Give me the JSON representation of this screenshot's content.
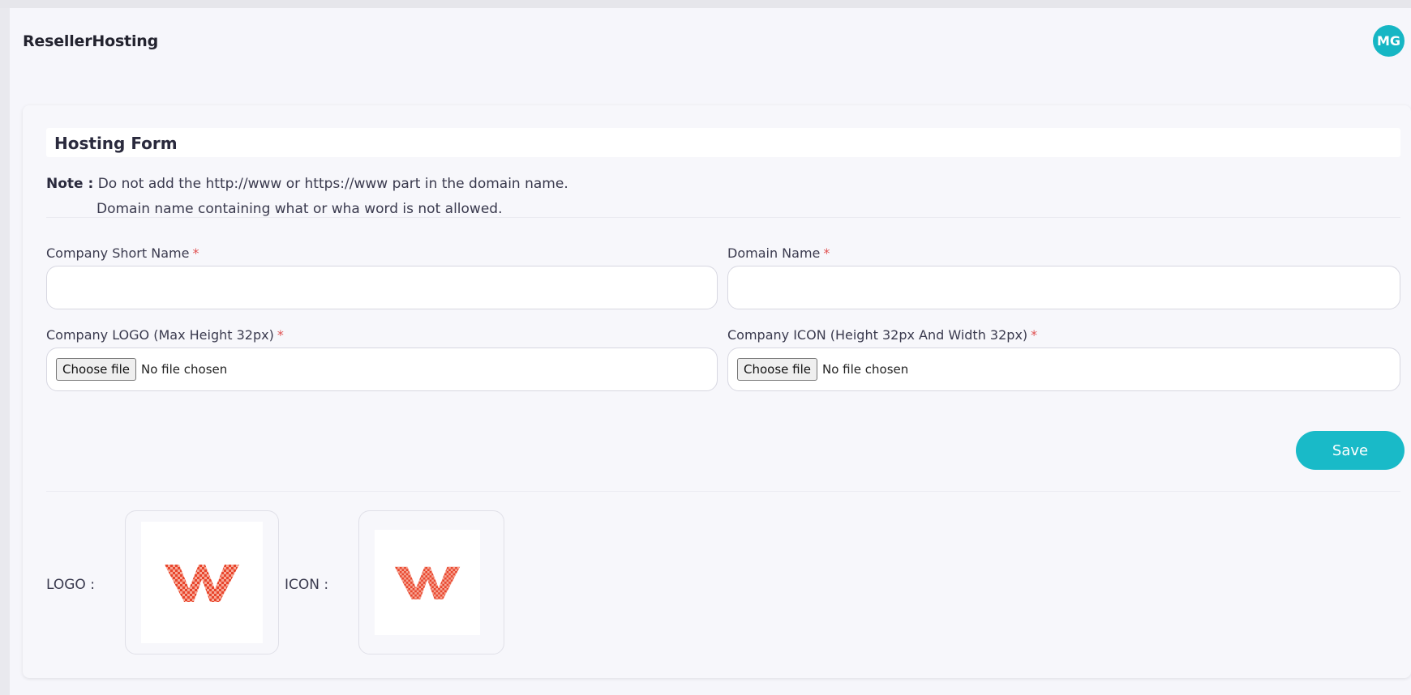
{
  "header": {
    "title": "ResellerHosting",
    "avatar_initials": "MG"
  },
  "form": {
    "title": "Hosting Form",
    "note_label": "Note :",
    "note_line1": "Do not add the http://www or https://www part in the domain name.",
    "note_line2": "Domain name containing what or wha word is not allowed.",
    "required_mark": "*",
    "fields": {
      "company_short_name": {
        "label": "Company Short Name",
        "value": "",
        "placeholder": ""
      },
      "domain_name": {
        "label": "Domain Name",
        "value": "",
        "placeholder": ""
      },
      "company_logo": {
        "label": "Company LOGO (Max Height 32px)",
        "button": "Choose file",
        "status": "No file chosen"
      },
      "company_icon": {
        "label": "Company ICON (Height 32px And Width 32px)",
        "button": "Choose file",
        "status": "No file chosen"
      }
    },
    "save_label": "Save"
  },
  "previews": {
    "logo_label": "LOGO :",
    "icon_label": "ICON :",
    "logo_image": "w-logo-icon",
    "icon_image": "w-logo-icon"
  },
  "colors": {
    "accent": "#19bac8",
    "avatar": "#16b6c4",
    "required": "#e05252",
    "logo_red": "#e8452c"
  }
}
